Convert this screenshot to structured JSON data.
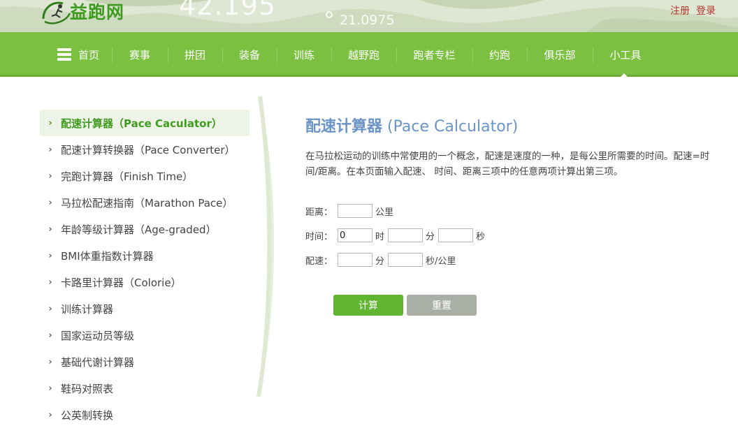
{
  "header": {
    "logo_text": "益跑网",
    "deco_big": "42.195",
    "deco_small": "21.0975",
    "register": "注册",
    "login": "登录"
  },
  "nav": {
    "items": [
      "首页",
      "赛事",
      "拼团",
      "装备",
      "训练",
      "越野跑",
      "跑者专栏",
      "约跑",
      "俱乐部",
      "小工具"
    ],
    "active": "小工具"
  },
  "sidebar": {
    "items": [
      "配速计算器（Pace Caculator）",
      "配速计算转换器（Pace Converter）",
      "完跑计算器（Finish Time）",
      "马拉松配速指南（Marathon Pace）",
      "年龄等级计算器（Age-graded）",
      "BMI体重指数计算器",
      "卡路里计算器（Colorie）",
      "训练计算器",
      "国家运动员等级",
      "基础代谢计算器",
      "鞋码对照表",
      "公英制转换"
    ],
    "active_index": 0
  },
  "main": {
    "title_cn": "配速计算器",
    "title_en": "(Pace Calculator)",
    "description": "在马拉松运动的训练中常使用的一个概念，配速是速度的一种，是每公里所需要的时间。配速=时间/距离。在本页面输入配速、 时间、距离三项中的任意两项计算出第三项。"
  },
  "form": {
    "distance_label": "距离：",
    "distance_value": "",
    "distance_unit": "公里",
    "time_label": "时间：",
    "time_hours_value": "0",
    "time_hours_unit": "时",
    "time_minutes_value": "",
    "time_minutes_unit": "分",
    "time_seconds_value": "",
    "time_seconds_unit": "秒",
    "pace_label": "配速：",
    "pace_minutes_value": "",
    "pace_minutes_unit": "分",
    "pace_seconds_value": "",
    "pace_seconds_unit": "秒/公里"
  },
  "buttons": {
    "calculate": "计算",
    "reset": "重置"
  },
  "colors": {
    "nav_green": "#7cc042",
    "brand_green": "#3f9b1f",
    "title_blue": "#6b94c7",
    "calc_button": "#5fb52d",
    "reset_button": "#a9afa4",
    "auth_red": "#b0372b"
  },
  "icons": {
    "menu": "hamburger-icon",
    "sidebar_bullet": "chevron-right-icon",
    "logo": "runner-logo-icon"
  }
}
